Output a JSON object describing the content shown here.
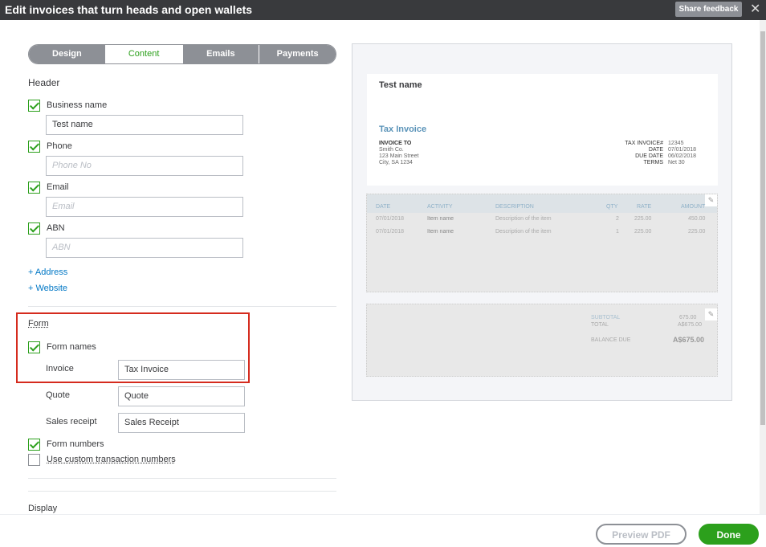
{
  "title": "Edit invoices that turn heads and open wallets",
  "share_feedback": "Share feedback",
  "tabs": [
    "Design",
    "Content",
    "Emails",
    "Payments"
  ],
  "header": {
    "section": "Header",
    "business_name": {
      "label": "Business name",
      "value": "Test name",
      "checked": true
    },
    "phone": {
      "label": "Phone",
      "placeholder": "Phone No",
      "checked": true
    },
    "email": {
      "label": "Email",
      "placeholder": "Email",
      "checked": true
    },
    "abn": {
      "label": "ABN",
      "placeholder": "ABN",
      "checked": true
    },
    "add_address": "+ Address",
    "add_website": "+ Website"
  },
  "form": {
    "section": "Form",
    "form_names": "Form names",
    "invoice_label": "Invoice",
    "invoice_value": "Tax Invoice",
    "quote_label": "Quote",
    "quote_value": "Quote",
    "sales_label": "Sales receipt",
    "sales_value": "Sales Receipt",
    "form_numbers": "Form numbers",
    "custom_numbers": "Use custom transaction numbers"
  },
  "display": "Display",
  "preview": {
    "business": "Test name",
    "form_title": "Tax Invoice",
    "invoice_to": "INVOICE TO",
    "address": [
      "Smith Co.",
      "123 Main Street",
      "City, SA 1234"
    ],
    "meta_labels": [
      "TAX INVOICE#",
      "DATE",
      "DUE DATE",
      "TERMS"
    ],
    "meta_values": [
      "12345",
      "07/01/2018",
      "06/02/2018",
      "Net 30"
    ],
    "columns": [
      "DATE",
      "ACTIVITY",
      "DESCRIPTION",
      "QTY",
      "RATE",
      "AMOUNT"
    ],
    "rows": [
      [
        "07/01/2018",
        "Item name",
        "Description of the item",
        "2",
        "225.00",
        "450.00"
      ],
      [
        "07/01/2018",
        "Item name",
        "Description of the item",
        "1",
        "225.00",
        "225.00"
      ]
    ],
    "subtotal_label": "SUBTOTAL",
    "subtotal": "675.00",
    "total_label": "TOTAL",
    "total": "A$675.00",
    "balance_label": "BALANCE DUE",
    "balance": "A$675.00"
  },
  "footer": {
    "preview_pdf": "Preview PDF",
    "done": "Done"
  },
  "colors": {
    "accent": "#2ca01c",
    "link": "#0077c5",
    "highlight": "#d52b1e",
    "titlebar": "#393a3d"
  }
}
